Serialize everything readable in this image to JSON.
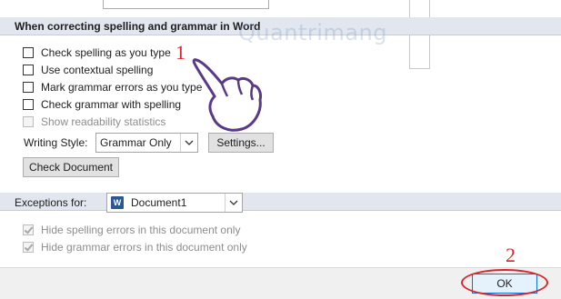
{
  "proofing": {
    "section_title": "When correcting spelling and grammar in Word",
    "checkboxes": [
      {
        "label": "Check spelling as you type",
        "checked": false
      },
      {
        "label": "Use contextual spelling",
        "checked": false
      },
      {
        "label": "Mark grammar errors as you type",
        "checked": false
      },
      {
        "label": "Check grammar with spelling",
        "checked": false
      },
      {
        "label": "Show readability statistics",
        "checked": false,
        "disabled": true
      }
    ],
    "writing_style_label": "Writing Style:",
    "writing_style_value": "Grammar Only",
    "settings_button": "Settings...",
    "check_document_button": "Check Document"
  },
  "exceptions": {
    "label": "Exceptions for:",
    "document_value": "Document1",
    "checkboxes": [
      {
        "label": "Hide spelling errors in this document only",
        "checked": true,
        "disabled": true
      },
      {
        "label": "Hide grammar errors in this document only",
        "checked": true,
        "disabled": true
      }
    ]
  },
  "footer": {
    "ok_button": "OK"
  },
  "annotations": {
    "step1": "1",
    "step2": "2",
    "watermark": "Quantrimang",
    "color": "#d7262e"
  },
  "colors": {
    "section_bar": "#e1e6ef",
    "ok_border": "#0078d7"
  }
}
